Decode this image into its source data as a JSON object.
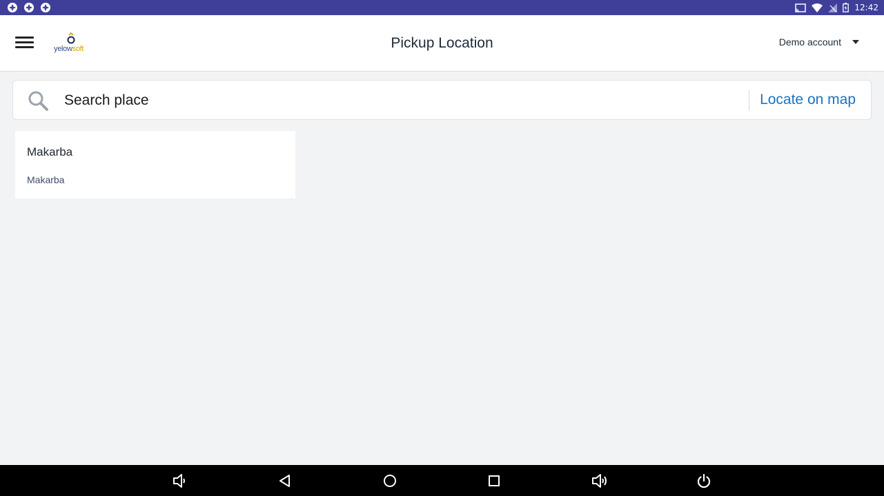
{
  "status_bar": {
    "time": "12:42",
    "left_icons": [
      "notification-icon",
      "notification-icon",
      "notification-icon"
    ],
    "right_icons": [
      "cast-icon",
      "wifi-icon",
      "no-signal-icon",
      "battery-charging-icon"
    ]
  },
  "app_bar": {
    "logo_text_part1": "yelow",
    "logo_text_part2": "soft",
    "title": "Pickup Location",
    "account_label": "Demo account"
  },
  "search": {
    "placeholder": "Search place",
    "value": "",
    "locate_label": "Locate on map"
  },
  "results": [
    {
      "title": "Makarba",
      "subtitle": "Makarba"
    }
  ],
  "nav_bar": {
    "buttons": [
      "volume-down-icon",
      "back-icon",
      "home-icon",
      "recents-icon",
      "volume-up-icon",
      "power-icon"
    ]
  },
  "colors": {
    "status_bar": "#3f3f9a",
    "accent": "#1a73c4",
    "background": "#f2f3f5"
  }
}
